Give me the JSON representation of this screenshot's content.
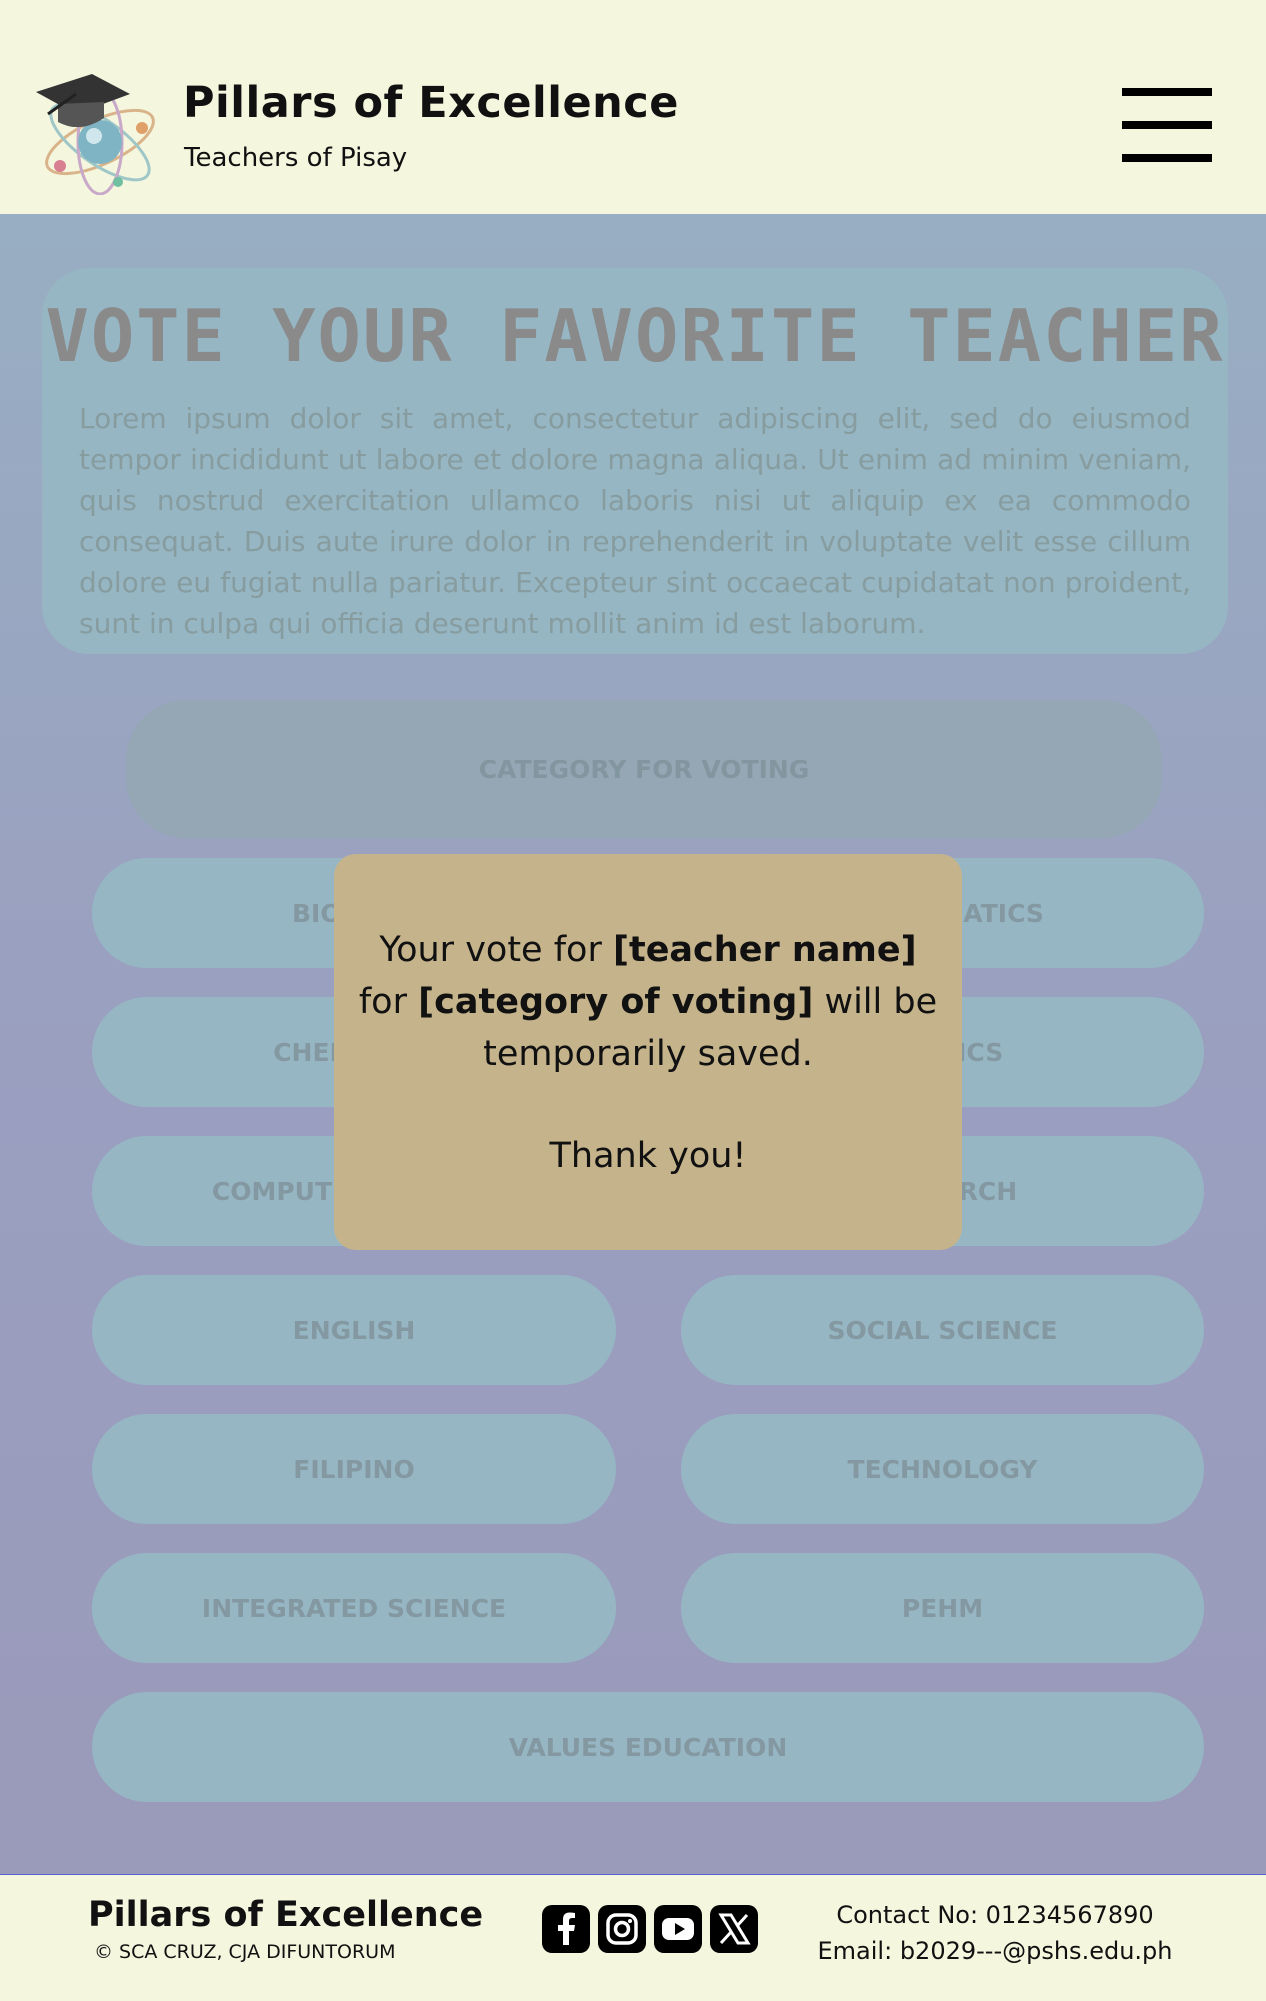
{
  "header": {
    "title": "Pillars of Excellence",
    "subtitle": "Teachers of Pisay",
    "menu_icon": "hamburger-menu-icon",
    "logo_icon": "graduation-cap-atom-logo"
  },
  "hero": {
    "title": "VOTE YOUR FAVORITE TEACHER",
    "body": "Lorem ipsum dolor sit amet, consectetur adipiscing elit, sed do eiusmod tempor incididunt ut labore et dolore magna aliqua. Ut enim ad minim veniam, quis nostrud exercitation ullamco laboris nisi ut aliquip ex ea commodo consequat. Duis aute irure dolor in reprehenderit in voluptate velit esse cillum dolore eu fugiat nulla pariatur. Excepteur sint occaecat cupidatat non proident, sunt in culpa qui officia deserunt mollit anim id est laborum."
  },
  "categories": {
    "header": "CATEGORY FOR VOTING",
    "items": [
      "BIOLOGY",
      "MATHEMATICS",
      "CHEMISTRY",
      "PHYSICS",
      "COMPUTER SCIENCE",
      "RESEARCH",
      "ENGLISH",
      "SOCIAL SCIENCE",
      "FILIPINO",
      "TECHNOLOGY",
      "INTEGRATED SCIENCE",
      "PEHM",
      "VALUES EDUCATION"
    ]
  },
  "modal": {
    "text_1": "Your vote for ",
    "teacher_placeholder": "[teacher name]",
    "text_2": " for ",
    "category_placeholder": "[category of voting]",
    "text_3": " will be temporarily saved.",
    "thanks": "Thank you!"
  },
  "footer": {
    "brand": "Pillars of Excellence",
    "copyright": "© SCA CRUZ, CJA DIFUNTORUM",
    "contact": "Contact No: 01234567890",
    "email": "Email: b2029---@pshs.edu.ph",
    "social_icons": [
      "facebook-icon",
      "instagram-icon",
      "youtube-icon",
      "x-icon"
    ]
  },
  "colors": {
    "page_bg": "#f5f6de",
    "panel_bg": "#96b6c4",
    "modal_bg": "#c5b38b"
  }
}
